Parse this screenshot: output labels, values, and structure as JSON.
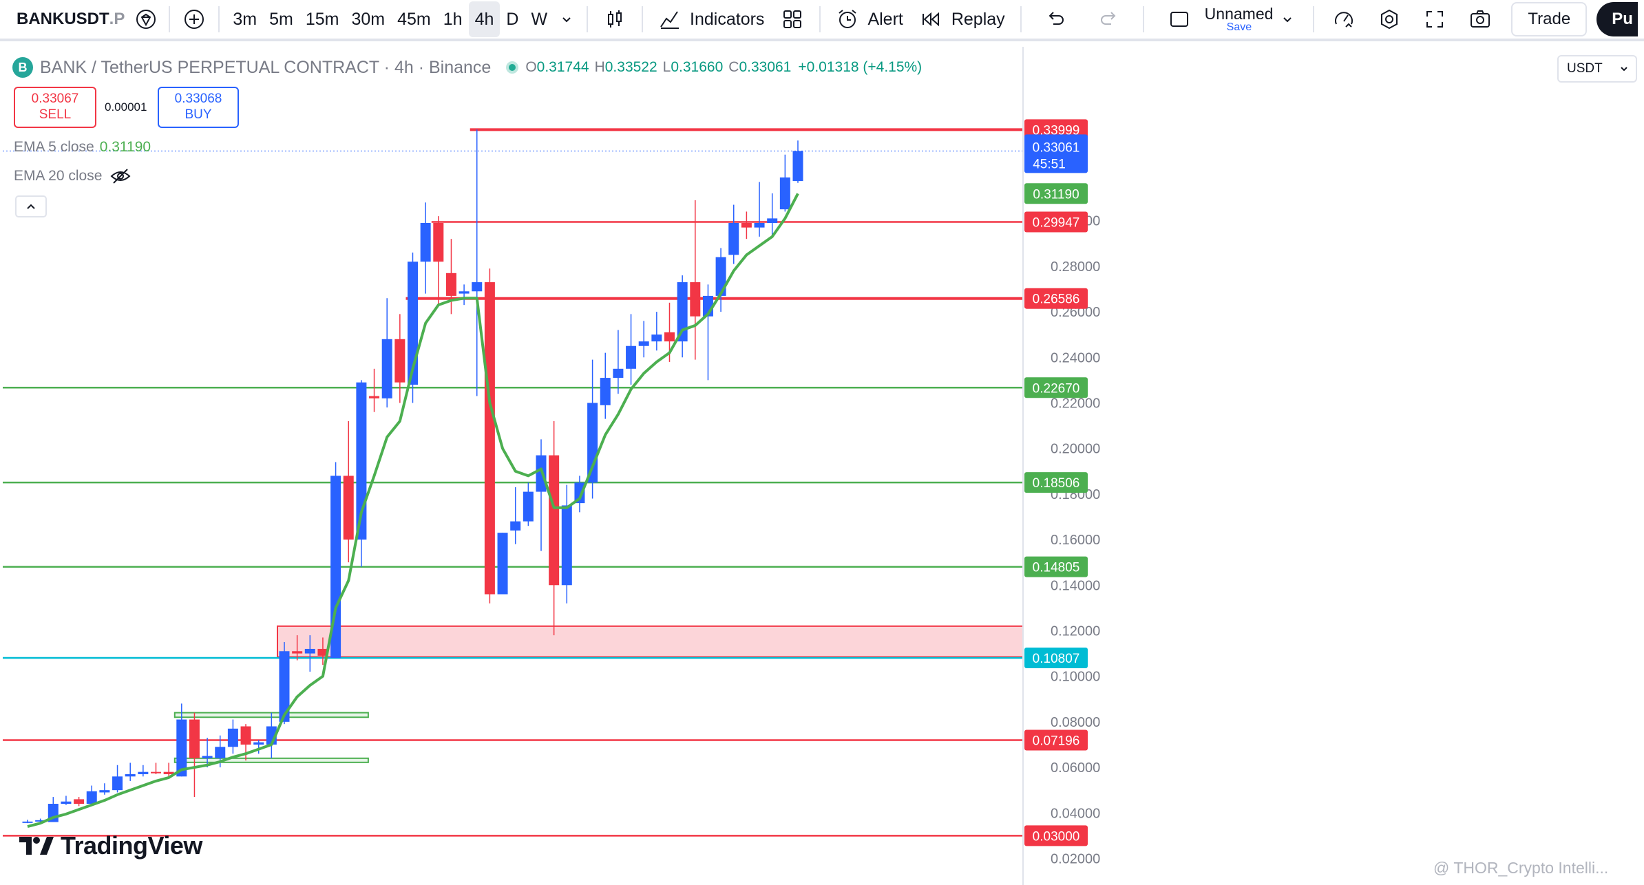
{
  "toolbar": {
    "symbol_bold": "BANKUSDT",
    "symbol_suffix": ".P",
    "intervals": [
      "3m",
      "5m",
      "15m",
      "30m",
      "45m",
      "1h",
      "4h",
      "D",
      "W"
    ],
    "active_interval": "4h",
    "indicators_label": "Indicators",
    "alert_label": "Alert",
    "replay_label": "Replay",
    "layout_name": "Unnamed",
    "save_label": "Save",
    "trade_label": "Trade",
    "publish_label": "Pu"
  },
  "legend": {
    "logo_letter": "B",
    "title": "BANK / TetherUS PERPETUAL CONTRACT · 4h · Binance",
    "o_label": "O",
    "o": "0.31744",
    "h_label": "H",
    "h": "0.33522",
    "l_label": "L",
    "l": "0.31660",
    "c_label": "C",
    "c": "0.33061",
    "change": "+0.01318 (+4.15%)"
  },
  "trading": {
    "sell_price": "0.33067",
    "sell_label": "SELL",
    "spread": "0.00001",
    "buy_price": "0.33068",
    "buy_label": "BUY"
  },
  "indicators": {
    "ema5_label": "EMA 5 close",
    "ema5_value": "0.31190",
    "ema20_label": "EMA 20 close"
  },
  "currency": "USDT",
  "branding": "TradingView",
  "watermark": "@ THOR_Crypto Intelli...",
  "colors": {
    "up": "#2962ff",
    "down": "#f23645",
    "ema": "#4caf50",
    "support": "#4caf50",
    "resistance": "#f23645",
    "key_level": "#00bcd4",
    "zone_fill": "#fcd5d9"
  },
  "chart_data": {
    "type": "candlestick",
    "symbol": "BANKUSDT.P",
    "interval": "4h",
    "ylim": [
      0.015,
      0.37
    ],
    "y_ticks": [
      "0.02000",
      "0.04000",
      "0.06000",
      "0.08000",
      "0.10000",
      "0.12000",
      "0.14000",
      "0.16000",
      "0.18000",
      "0.20000",
      "0.22000",
      "0.24000",
      "0.26000",
      "0.28000",
      "0.30000"
    ],
    "candles": [
      {
        "o": 0.036,
        "h": 0.037,
        "l": 0.0355,
        "c": 0.0362
      },
      {
        "o": 0.0362,
        "h": 0.0375,
        "l": 0.0355,
        "c": 0.0368
      },
      {
        "o": 0.036,
        "h": 0.047,
        "l": 0.036,
        "c": 0.044
      },
      {
        "o": 0.044,
        "h": 0.0475,
        "l": 0.0435,
        "c": 0.045
      },
      {
        "o": 0.046,
        "h": 0.047,
        "l": 0.043,
        "c": 0.044
      },
      {
        "o": 0.044,
        "h": 0.052,
        "l": 0.044,
        "c": 0.0495
      },
      {
        "o": 0.049,
        "h": 0.053,
        "l": 0.048,
        "c": 0.05
      },
      {
        "o": 0.05,
        "h": 0.061,
        "l": 0.049,
        "c": 0.056
      },
      {
        "o": 0.056,
        "h": 0.062,
        "l": 0.054,
        "c": 0.057
      },
      {
        "o": 0.057,
        "h": 0.061,
        "l": 0.056,
        "c": 0.058
      },
      {
        "o": 0.058,
        "h": 0.062,
        "l": 0.057,
        "c": 0.0575
      },
      {
        "o": 0.058,
        "h": 0.062,
        "l": 0.056,
        "c": 0.057
      },
      {
        "o": 0.056,
        "h": 0.088,
        "l": 0.056,
        "c": 0.081
      },
      {
        "o": 0.081,
        "h": 0.084,
        "l": 0.047,
        "c": 0.064
      },
      {
        "o": 0.064,
        "h": 0.073,
        "l": 0.06,
        "c": 0.065
      },
      {
        "o": 0.064,
        "h": 0.074,
        "l": 0.06,
        "c": 0.069
      },
      {
        "o": 0.069,
        "h": 0.081,
        "l": 0.066,
        "c": 0.077
      },
      {
        "o": 0.078,
        "h": 0.079,
        "l": 0.063,
        "c": 0.07
      },
      {
        "o": 0.07,
        "h": 0.072,
        "l": 0.066,
        "c": 0.071
      },
      {
        "o": 0.07,
        "h": 0.084,
        "l": 0.064,
        "c": 0.078
      },
      {
        "o": 0.08,
        "h": 0.115,
        "l": 0.079,
        "c": 0.111
      },
      {
        "o": 0.111,
        "h": 0.118,
        "l": 0.107,
        "c": 0.11
      },
      {
        "o": 0.11,
        "h": 0.118,
        "l": 0.102,
        "c": 0.112
      },
      {
        "o": 0.112,
        "h": 0.117,
        "l": 0.105,
        "c": 0.109
      },
      {
        "o": 0.108,
        "h": 0.194,
        "l": 0.108,
        "c": 0.188
      },
      {
        "o": 0.188,
        "h": 0.212,
        "l": 0.15,
        "c": 0.16
      },
      {
        "o": 0.16,
        "h": 0.23,
        "l": 0.148,
        "c": 0.229
      },
      {
        "o": 0.223,
        "h": 0.235,
        "l": 0.216,
        "c": 0.222
      },
      {
        "o": 0.222,
        "h": 0.266,
        "l": 0.218,
        "c": 0.248
      },
      {
        "o": 0.248,
        "h": 0.259,
        "l": 0.22,
        "c": 0.229
      },
      {
        "o": 0.228,
        "h": 0.286,
        "l": 0.22,
        "c": 0.282
      },
      {
        "o": 0.282,
        "h": 0.308,
        "l": 0.268,
        "c": 0.299
      },
      {
        "o": 0.299,
        "h": 0.302,
        "l": 0.263,
        "c": 0.282
      },
      {
        "o": 0.277,
        "h": 0.292,
        "l": 0.259,
        "c": 0.267
      },
      {
        "o": 0.268,
        "h": 0.272,
        "l": 0.263,
        "c": 0.269
      },
      {
        "o": 0.269,
        "h": 0.34,
        "l": 0.223,
        "c": 0.273
      },
      {
        "o": 0.273,
        "h": 0.279,
        "l": 0.132,
        "c": 0.136
      },
      {
        "o": 0.136,
        "h": 0.163,
        "l": 0.136,
        "c": 0.163
      },
      {
        "o": 0.164,
        "h": 0.183,
        "l": 0.158,
        "c": 0.168
      },
      {
        "o": 0.168,
        "h": 0.185,
        "l": 0.166,
        "c": 0.181
      },
      {
        "o": 0.181,
        "h": 0.204,
        "l": 0.155,
        "c": 0.197
      },
      {
        "o": 0.197,
        "h": 0.212,
        "l": 0.118,
        "c": 0.14
      },
      {
        "o": 0.14,
        "h": 0.184,
        "l": 0.132,
        "c": 0.175
      },
      {
        "o": 0.176,
        "h": 0.188,
        "l": 0.172,
        "c": 0.185
      },
      {
        "o": 0.185,
        "h": 0.239,
        "l": 0.178,
        "c": 0.22
      },
      {
        "o": 0.219,
        "h": 0.242,
        "l": 0.213,
        "c": 0.231
      },
      {
        "o": 0.231,
        "h": 0.252,
        "l": 0.224,
        "c": 0.235
      },
      {
        "o": 0.235,
        "h": 0.259,
        "l": 0.228,
        "c": 0.245
      },
      {
        "o": 0.245,
        "h": 0.256,
        "l": 0.24,
        "c": 0.247
      },
      {
        "o": 0.247,
        "h": 0.26,
        "l": 0.243,
        "c": 0.25
      },
      {
        "o": 0.251,
        "h": 0.264,
        "l": 0.238,
        "c": 0.247
      },
      {
        "o": 0.247,
        "h": 0.276,
        "l": 0.24,
        "c": 0.273
      },
      {
        "o": 0.273,
        "h": 0.309,
        "l": 0.239,
        "c": 0.258
      },
      {
        "o": 0.258,
        "h": 0.272,
        "l": 0.23,
        "c": 0.267
      },
      {
        "o": 0.267,
        "h": 0.288,
        "l": 0.26,
        "c": 0.284
      },
      {
        "o": 0.285,
        "h": 0.307,
        "l": 0.281,
        "c": 0.299
      },
      {
        "o": 0.299,
        "h": 0.304,
        "l": 0.292,
        "c": 0.297
      },
      {
        "o": 0.297,
        "h": 0.317,
        "l": 0.293,
        "c": 0.299
      },
      {
        "o": 0.299,
        "h": 0.312,
        "l": 0.293,
        "c": 0.301
      },
      {
        "o": 0.305,
        "h": 0.329,
        "l": 0.304,
        "c": 0.319
      },
      {
        "o": 0.3174,
        "h": 0.3352,
        "l": 0.3166,
        "c": 0.3306
      }
    ],
    "ema5": [
      0.034,
      0.0355,
      0.038,
      0.0395,
      0.0415,
      0.0435,
      0.0455,
      0.048,
      0.05,
      0.052,
      0.054,
      0.0555,
      0.059,
      0.06,
      0.061,
      0.0625,
      0.0645,
      0.066,
      0.068,
      0.07,
      0.083,
      0.091,
      0.096,
      0.1,
      0.13,
      0.142,
      0.172,
      0.188,
      0.205,
      0.212,
      0.235,
      0.255,
      0.263,
      0.265,
      0.266,
      0.266,
      0.22,
      0.2,
      0.19,
      0.188,
      0.191,
      0.174,
      0.174,
      0.178,
      0.192,
      0.206,
      0.215,
      0.226,
      0.233,
      0.238,
      0.242,
      0.252,
      0.254,
      0.259,
      0.268,
      0.278,
      0.285,
      0.289,
      0.293,
      0.301,
      0.3119
    ],
    "horizontal_levels": [
      {
        "price": 0.33999,
        "label": "0.33999",
        "color": "#f23645",
        "style": "ray",
        "from_index": 35
      },
      {
        "price": 0.29947,
        "label": "0.29947",
        "color": "#f23645",
        "style": "ray",
        "from_index": 32
      },
      {
        "price": 0.26586,
        "label": "0.26586",
        "color": "#f23645",
        "style": "ray",
        "from_index": 30
      },
      {
        "price": 0.2267,
        "label": "0.22670",
        "color": "#4caf50",
        "style": "full"
      },
      {
        "price": 0.18506,
        "label": "0.18506",
        "color": "#4caf50",
        "style": "full"
      },
      {
        "price": 0.14805,
        "label": "0.14805",
        "color": "#4caf50",
        "style": "full"
      },
      {
        "price": 0.10807,
        "label": "0.10807",
        "color": "#00bcd4",
        "style": "full"
      },
      {
        "price": 0.07196,
        "label": "0.07196",
        "color": "#f23645",
        "style": "full"
      },
      {
        "price": 0.03,
        "label": "0.03000",
        "color": "#f23645",
        "style": "full"
      }
    ],
    "zones": [
      {
        "from_index": 20,
        "top": 0.122,
        "bottom": 0.1085,
        "fill": "#fcd5d9",
        "stroke": "#f23645"
      },
      {
        "from_index": 12,
        "to_index": 26,
        "top": 0.084,
        "bottom": 0.082,
        "fill": "#e6f4e7",
        "stroke": "#4caf50"
      },
      {
        "from_index": 12,
        "to_index": 26,
        "top": 0.064,
        "bottom": 0.063,
        "fill": "#e6f4e7",
        "stroke": "#4caf50"
      }
    ],
    "last_price": {
      "value": "0.33061",
      "countdown": "45:51"
    },
    "ema_price_label": "0.31190"
  }
}
